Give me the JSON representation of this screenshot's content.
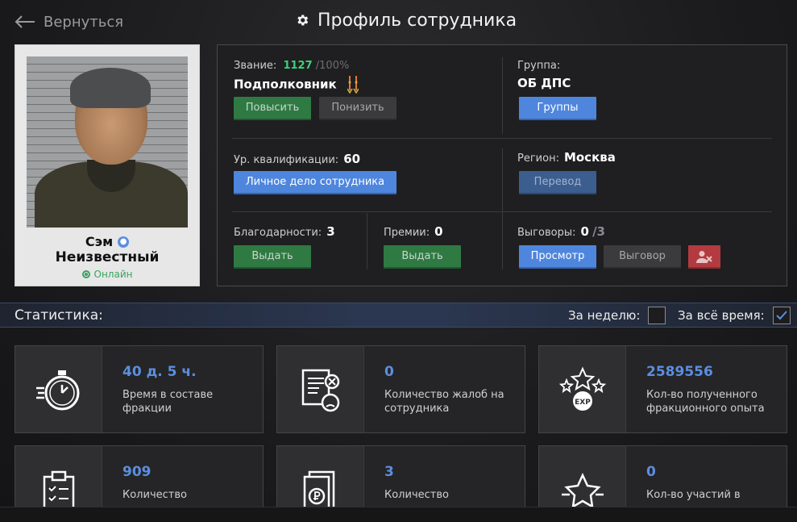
{
  "header": {
    "back_label": "Вернуться",
    "title": "Профиль сотрудника"
  },
  "profile": {
    "first_name": "Сэм",
    "last_name": "Неизвестный",
    "status": "Онлайн"
  },
  "rank": {
    "label": "Звание:",
    "value": "1127",
    "max": "/100%",
    "name": "Подполковник",
    "promote_label": "Повысить",
    "demote_label": "Понизить"
  },
  "group": {
    "label": "Группа:",
    "name": "ОБ ДПС",
    "button_label": "Группы"
  },
  "qualification": {
    "label": "Ур. квалификации:",
    "value": "60",
    "button_label": "Личное дело сотрудника"
  },
  "region": {
    "label": "Регион:",
    "value": "Москва",
    "button_label": "Перевод"
  },
  "thanks": {
    "label": "Благодарности:",
    "value": "3",
    "button_label": "Выдать"
  },
  "bonuses": {
    "label": "Премии:",
    "value": "0",
    "button_label": "Выдать"
  },
  "reprimands": {
    "label": "Выговоры:",
    "value": "0",
    "max": "/3",
    "view_label": "Просмотр",
    "issue_label": "Выговор"
  },
  "stats": {
    "title": "Статистика:",
    "week_label": "За неделю:",
    "week_checked": false,
    "all_time_label": "За всё время:",
    "all_time_checked": true,
    "cards": [
      {
        "value": "40 д. 5 ч.",
        "desc": "Время в составе фракции",
        "icon": "stopwatch-icon"
      },
      {
        "value": "0",
        "desc": "Количество жалоб на сотрудника",
        "icon": "complaint-icon"
      },
      {
        "value": "2589556",
        "desc": "Кол-во полученного фракционного опыта",
        "icon": "exp-icon"
      },
      {
        "value": "909",
        "desc": "Количество",
        "icon": "clipboard-icon"
      },
      {
        "value": "3",
        "desc": "Количество",
        "icon": "money-doc-icon"
      },
      {
        "value": "0",
        "desc": "Кол-во участий в",
        "icon": "star-icon"
      }
    ]
  },
  "colors": {
    "accent_blue": "#5b8ee0",
    "green": "#2f7a43",
    "red": "#b33b3f",
    "online": "#3aa35d",
    "rank_value": "#3bd37a"
  }
}
